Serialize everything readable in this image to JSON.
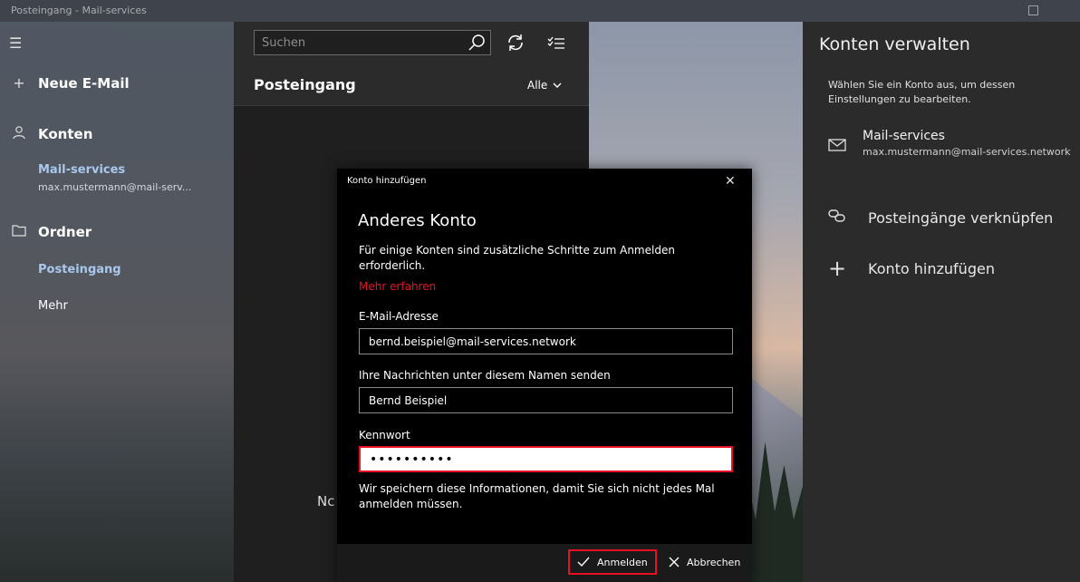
{
  "window": {
    "title": "Posteingang - Mail-services"
  },
  "nav": {
    "new_mail": "Neue E-Mail",
    "accounts_heading": "Konten",
    "account": {
      "name": "Mail-services",
      "email": "max.mustermann@mail-serv..."
    },
    "folders_heading": "Ordner",
    "folders": [
      "Posteingang",
      "Mehr"
    ]
  },
  "list": {
    "search_placeholder": "Suchen",
    "title": "Posteingang",
    "filter": "Alle",
    "empty_fragment": "Nc"
  },
  "panel": {
    "title": "Konten verwalten",
    "description": "Wählen Sie ein Konto aus, um dessen Einstellungen zu bearbeiten.",
    "account": {
      "name": "Mail-services",
      "email": "max.mustermann@mail-services.network"
    },
    "link_inboxes": "Posteingänge verknüpfen",
    "add_account": "Konto hinzufügen"
  },
  "dialog": {
    "caption": "Konto hinzufügen",
    "heading": "Anderes Konto",
    "info": "Für einige Konten sind zusätzliche Schritte zum Anmelden erforderlich.",
    "learn_more": "Mehr erfahren",
    "email_label": "E-Mail-Adresse",
    "email_value": "bernd.beispiel@mail-services.network",
    "name_label": "Ihre Nachrichten unter diesem Namen senden",
    "name_value": "Bernd Beispiel",
    "password_label": "Kennwort",
    "password_value": "••••••••••",
    "save_note": "Wir speichern diese Informationen, damit Sie sich nicht jedes Mal anmelden müssen.",
    "sign_in": "Anmelden",
    "cancel": "Abbrechen"
  },
  "colors": {
    "accent": "#e81123",
    "account_link": "#a9c8ee"
  }
}
